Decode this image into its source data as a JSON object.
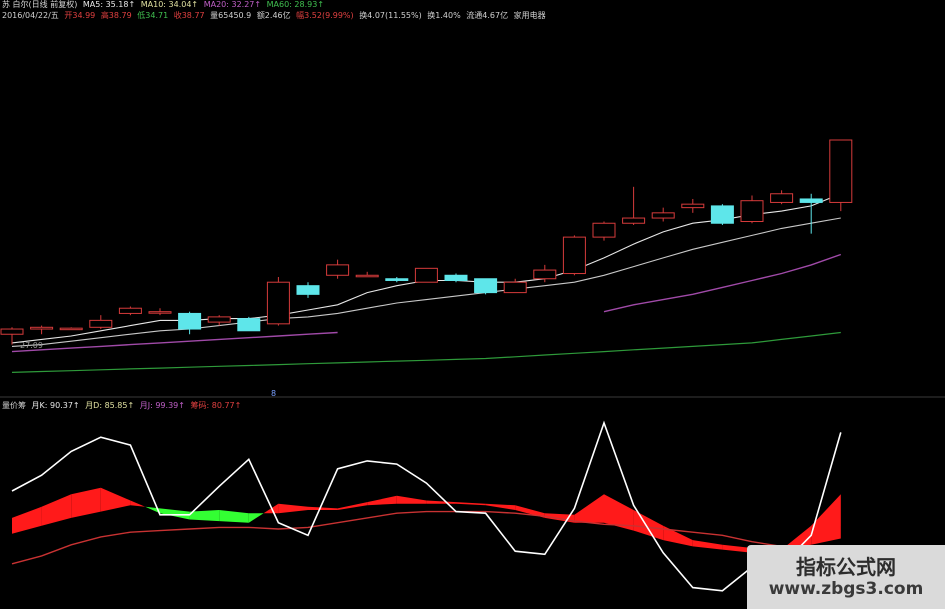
{
  "header": {
    "line1": {
      "title": "苏 白尔(日线 前复权)",
      "ma5": "MA5: 35.18↑",
      "ma10": "MA10: 34.04↑",
      "ma20": "MA20: 32.27↑",
      "ma60": "MA60: 28.93↑"
    },
    "line2": {
      "date": "2016/04/22/五",
      "open": "开34.99",
      "high": "高38.79",
      "low": "低34.71",
      "close": "收38.77",
      "volume": "量65450.9",
      "amount": "额2.46亿",
      "change": "幅3.52(9.99%)",
      "turnover": "换4.07(11.55%)",
      "ratio": "换1.40%",
      "float": "流通4.67亿",
      "sector": "家用电器"
    },
    "line3": {
      "name": "量价筹",
      "k": "月K: 90.37↑",
      "d": "月D: 85.85↑",
      "j": "月J: 99.39↑",
      "extra": "筹码: 80.77↑"
    }
  },
  "left_price_label": "27.09",
  "divider_tag": "8",
  "watermark": {
    "title": "指标公式网",
    "url": "www.zbgs3.com"
  },
  "colors": {
    "up": "#d63b3b",
    "down": "#5ee6ea",
    "ma5": "#e6e6e6",
    "ma10": "#c8c8c8",
    "ma20": "#a04aa8",
    "ma60": "#2e9a3a",
    "kdj_j": "#ffffff",
    "kdj_d": "#c83232",
    "fill_pos": "#ff1a1a",
    "fill_neg": "#33ff33"
  },
  "chart_data": [
    {
      "type": "candlestick",
      "series": [
        {
          "name": "MA5"
        },
        {
          "name": "MA10"
        },
        {
          "name": "MA20"
        },
        {
          "name": "MA60"
        }
      ],
      "ohlc": [
        {
          "o": 27.6,
          "h": 28.0,
          "l": 27.0,
          "c": 27.9
        },
        {
          "o": 27.9,
          "h": 28.1,
          "l": 27.6,
          "c": 28.0
        },
        {
          "o": 27.95,
          "h": 28.0,
          "l": 27.9,
          "c": 27.95
        },
        {
          "o": 28.0,
          "h": 28.7,
          "l": 27.9,
          "c": 28.4
        },
        {
          "o": 28.8,
          "h": 29.2,
          "l": 28.7,
          "c": 29.1
        },
        {
          "o": 28.9,
          "h": 29.1,
          "l": 28.7,
          "c": 28.9
        },
        {
          "o": 28.8,
          "h": 28.9,
          "l": 27.6,
          "c": 27.9
        },
        {
          "o": 28.3,
          "h": 28.7,
          "l": 28.1,
          "c": 28.6
        },
        {
          "o": 28.5,
          "h": 28.6,
          "l": 27.8,
          "c": 27.8
        },
        {
          "o": 28.2,
          "h": 30.9,
          "l": 28.1,
          "c": 30.6
        },
        {
          "o": 30.4,
          "h": 30.6,
          "l": 29.7,
          "c": 29.9
        },
        {
          "o": 31.0,
          "h": 31.9,
          "l": 30.8,
          "c": 31.6
        },
        {
          "o": 31.0,
          "h": 31.2,
          "l": 30.9,
          "c": 31.0
        },
        {
          "o": 30.8,
          "h": 30.9,
          "l": 30.6,
          "c": 30.7
        },
        {
          "o": 30.6,
          "h": 31.4,
          "l": 30.6,
          "c": 31.4
        },
        {
          "o": 31.0,
          "h": 31.1,
          "l": 30.6,
          "c": 30.7
        },
        {
          "o": 30.8,
          "h": 30.8,
          "l": 29.9,
          "c": 30.0
        },
        {
          "o": 30.0,
          "h": 30.8,
          "l": 30.0,
          "c": 30.6
        },
        {
          "o": 30.8,
          "h": 31.6,
          "l": 30.6,
          "c": 31.3
        },
        {
          "o": 31.1,
          "h": 33.3,
          "l": 31.0,
          "c": 33.2
        },
        {
          "o": 33.2,
          "h": 34.1,
          "l": 33.0,
          "c": 34.0
        },
        {
          "o": 34.0,
          "h": 36.1,
          "l": 33.9,
          "c": 34.3
        },
        {
          "o": 34.3,
          "h": 34.9,
          "l": 34.1,
          "c": 34.6
        },
        {
          "o": 34.9,
          "h": 35.4,
          "l": 34.6,
          "c": 35.1
        },
        {
          "o": 35.0,
          "h": 35.1,
          "l": 33.9,
          "c": 34.0
        },
        {
          "o": 34.1,
          "h": 35.6,
          "l": 34.0,
          "c": 35.3
        },
        {
          "o": 35.2,
          "h": 35.9,
          "l": 35.1,
          "c": 35.7
        },
        {
          "o": 35.4,
          "h": 35.7,
          "l": 33.4,
          "c": 35.2
        },
        {
          "o": 35.2,
          "h": 38.8,
          "l": 34.7,
          "c": 38.8
        }
      ],
      "ma5": [
        27.1,
        27.3,
        27.5,
        27.8,
        28.1,
        28.4,
        28.4,
        28.5,
        28.5,
        28.7,
        29.0,
        29.3,
        30.0,
        30.4,
        30.7,
        30.7,
        30.6,
        30.6,
        30.8,
        31.3,
        32.0,
        32.8,
        33.5,
        34.0,
        34.2,
        34.5,
        34.7,
        35.0,
        35.7
      ],
      "ma10": [
        26.9,
        27.0,
        27.2,
        27.4,
        27.6,
        27.8,
        27.9,
        28.1,
        28.3,
        28.5,
        28.6,
        28.8,
        29.1,
        29.4,
        29.6,
        29.8,
        30.0,
        30.2,
        30.4,
        30.6,
        31.0,
        31.5,
        32.0,
        32.5,
        32.9,
        33.3,
        33.7,
        34.0,
        34.3
      ],
      "ma20": [
        26.6,
        26.7,
        26.8,
        26.9,
        27.0,
        27.1,
        27.2,
        27.3,
        27.4,
        27.5,
        27.6,
        27.7,
        null,
        null,
        null,
        null,
        null,
        null,
        null,
        null,
        28.9,
        29.3,
        29.6,
        29.9,
        30.3,
        30.7,
        31.1,
        31.6,
        32.2
      ],
      "ma60": [
        25.4,
        25.45,
        25.5,
        25.55,
        25.6,
        25.65,
        25.7,
        25.75,
        25.8,
        25.85,
        25.9,
        25.95,
        26.0,
        26.05,
        26.1,
        26.15,
        26.2,
        26.3,
        26.4,
        26.5,
        26.6,
        26.7,
        26.8,
        26.9,
        27.0,
        27.1,
        27.3,
        27.5,
        27.7
      ],
      "ylim": [
        24.5,
        38.8
      ]
    },
    {
      "type": "line",
      "series": [
        {
          "name": "月J",
          "values": [
            72,
            82,
            97,
            106,
            101,
            57,
            57,
            75,
            92,
            52,
            44,
            86,
            91,
            89,
            77,
            59,
            58,
            34,
            32,
            61,
            115,
            63,
            33,
            11,
            9,
            24,
            25,
            44,
            109
          ]
        },
        {
          "name": "月D",
          "values": [
            26,
            31,
            38,
            43,
            46,
            47,
            48,
            49,
            49,
            48,
            49,
            52,
            55,
            58,
            59,
            59,
            59,
            58,
            56,
            53,
            51,
            50,
            48,
            46,
            44,
            40,
            37,
            32,
            30
          ]
        },
        {
          "name": "band_a",
          "values": [
            55,
            62,
            70,
            74,
            66,
            58,
            54,
            53,
            52,
            64,
            62,
            61,
            65,
            69,
            66,
            65,
            64,
            63,
            58,
            57,
            70,
            60,
            50,
            41,
            38,
            36,
            35,
            50,
            70
          ]
        },
        {
          "name": "band_b",
          "values": [
            45,
            50,
            55,
            59,
            63,
            61,
            59,
            60,
            58,
            58,
            60,
            60,
            63,
            64,
            64,
            64,
            63,
            60,
            55,
            52,
            52,
            47,
            41,
            37,
            35,
            33,
            36,
            38,
            42
          ]
        }
      ],
      "ylim": [
        0,
        120
      ]
    }
  ]
}
